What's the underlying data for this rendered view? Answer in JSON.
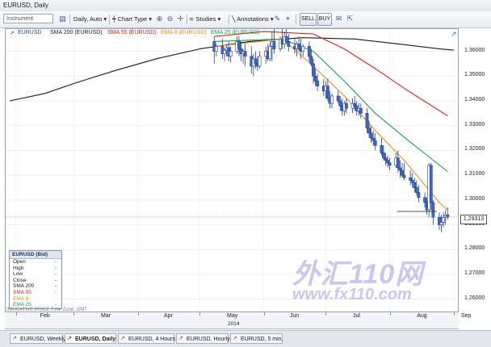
{
  "window": {
    "title": "EURUSD, Daily"
  },
  "toolbar": {
    "instrument_placeholder": "Instrument",
    "period_label": "Daily, Auto",
    "chart_type_label": "Chart Type",
    "studies_label": "Studies",
    "annotations_label": "Annotations",
    "sell_label": "SELL",
    "buy_label": "BUY",
    "icons": [
      "chart-icon",
      "zoom-in-icon",
      "zoom-out-icon",
      "crosshair-icon",
      "studies-icon",
      "line-icon",
      "pencil-icon",
      "cursor-icon",
      "email-icon",
      "export-icon"
    ]
  },
  "legend_bar": {
    "symbol": "EURUSD",
    "items": [
      {
        "label": "SMA 200 (EURUSD)",
        "color": "#1a1a1a"
      },
      {
        "label": "SMA 55 (EURUSD)",
        "color": "#e2231a"
      },
      {
        "label": "EMA 8 (EURUSD)",
        "color": "#f28b1e"
      },
      {
        "label": "EMA 25 (EURUSD)",
        "color": "#14a44d"
      }
    ]
  },
  "info_box": {
    "title": "EURUSD (Bid)",
    "rows": [
      {
        "label": "Open",
        "value": "-",
        "color": "#1a1a1a"
      },
      {
        "label": "High",
        "value": "-",
        "color": "#1a1a1a"
      },
      {
        "label": "Low",
        "value": "-",
        "color": "#1a1a1a"
      },
      {
        "label": "Close",
        "value": "-",
        "color": "#1a1a1a"
      },
      {
        "label": "SMA 200",
        "value": "-",
        "color": "#1a1a1a"
      },
      {
        "label": "SMA 55",
        "value": "-",
        "color": "#e2231a"
      },
      {
        "label": "EMA 8",
        "value": "-",
        "color": "#f28b1e"
      },
      {
        "label": "EMA 25",
        "value": "-",
        "color": "#14a44d"
      }
    ]
  },
  "footer_note": "INDICATIVE PRICE    Time Zone: GMT",
  "current_price": "1.29313",
  "tabs": [
    {
      "label": "EURUSD, Weekly",
      "active": false
    },
    {
      "label": "EURUSD, Daily",
      "active": true
    },
    {
      "label": "EURUSD, 4 Hours",
      "active": false
    },
    {
      "label": "EURUSD, Hourly",
      "active": false
    },
    {
      "label": "EURUSD, 5 min.",
      "active": false
    }
  ],
  "watermark": {
    "brand": "外汇110网",
    "url": "www.fx110.com"
  },
  "chart_data": {
    "type": "candlestick",
    "title": "EURUSD, Daily",
    "xlabel": "2014",
    "ylabel": "",
    "x_tick_labels": [
      "Feb",
      "Mar",
      "Apr",
      "May",
      "Jun",
      "Jul",
      "Aug",
      "Sep"
    ],
    "y_tick_labels": [
      "1.36000",
      "1.35000",
      "1.34000",
      "1.33000",
      "1.32000",
      "1.31000",
      "1.30000",
      "1.29000",
      "1.28000",
      "1.27000",
      "1.26000"
    ],
    "ylim": [
      1.255,
      1.369
    ],
    "grid": true,
    "current_price": 1.29313,
    "colors": {
      "up": "#ffffff",
      "down": "#3d67c9",
      "wick": "#1f3f8f",
      "price_line": "#e45a5a"
    },
    "candles": [
      {
        "d": "2014-05-08",
        "o": 1.364,
        "h": 1.366,
        "l": 1.355,
        "c": 1.36
      },
      {
        "d": "2014-05-09",
        "o": 1.36,
        "h": 1.363,
        "l": 1.358,
        "c": 1.362
      },
      {
        "d": "2014-05-12",
        "o": 1.362,
        "h": 1.365,
        "l": 1.357,
        "c": 1.359
      },
      {
        "d": "2014-05-13",
        "o": 1.359,
        "h": 1.361,
        "l": 1.356,
        "c": 1.3605
      },
      {
        "d": "2014-05-14",
        "o": 1.3605,
        "h": 1.363,
        "l": 1.358,
        "c": 1.3615
      },
      {
        "d": "2014-05-15",
        "o": 1.3615,
        "h": 1.364,
        "l": 1.356,
        "c": 1.358
      },
      {
        "d": "2014-05-16",
        "o": 1.358,
        "h": 1.362,
        "l": 1.3555,
        "c": 1.36
      },
      {
        "d": "2014-05-19",
        "o": 1.36,
        "h": 1.366,
        "l": 1.359,
        "c": 1.364
      },
      {
        "d": "2014-05-20",
        "o": 1.364,
        "h": 1.366,
        "l": 1.358,
        "c": 1.361
      },
      {
        "d": "2014-05-21",
        "o": 1.361,
        "h": 1.364,
        "l": 1.356,
        "c": 1.359
      },
      {
        "d": "2014-05-22",
        "o": 1.359,
        "h": 1.361,
        "l": 1.355,
        "c": 1.36
      },
      {
        "d": "2014-05-23",
        "o": 1.36,
        "h": 1.363,
        "l": 1.354,
        "c": 1.358
      },
      {
        "d": "2014-05-26",
        "o": 1.358,
        "h": 1.362,
        "l": 1.351,
        "c": 1.354
      },
      {
        "d": "2014-05-27",
        "o": 1.354,
        "h": 1.359,
        "l": 1.35,
        "c": 1.357
      },
      {
        "d": "2014-05-28",
        "o": 1.357,
        "h": 1.36,
        "l": 1.353,
        "c": 1.355
      },
      {
        "d": "2014-05-29",
        "o": 1.355,
        "h": 1.358,
        "l": 1.352,
        "c": 1.354
      },
      {
        "d": "2014-05-30",
        "o": 1.354,
        "h": 1.36,
        "l": 1.353,
        "c": 1.358
      },
      {
        "d": "2014-06-02",
        "o": 1.358,
        "h": 1.362,
        "l": 1.355,
        "c": 1.36
      },
      {
        "d": "2014-06-03",
        "o": 1.36,
        "h": 1.363,
        "l": 1.356,
        "c": 1.357
      },
      {
        "d": "2014-06-04",
        "o": 1.357,
        "h": 1.364,
        "l": 1.356,
        "c": 1.362
      },
      {
        "d": "2014-06-05",
        "o": 1.362,
        "h": 1.368,
        "l": 1.356,
        "c": 1.364
      },
      {
        "d": "2014-06-06",
        "o": 1.364,
        "h": 1.369,
        "l": 1.359,
        "c": 1.361
      },
      {
        "d": "2014-06-09",
        "o": 1.361,
        "h": 1.366,
        "l": 1.36,
        "c": 1.365
      },
      {
        "d": "2014-06-10",
        "o": 1.365,
        "h": 1.369,
        "l": 1.361,
        "c": 1.363
      },
      {
        "d": "2014-06-11",
        "o": 1.363,
        "h": 1.368,
        "l": 1.361,
        "c": 1.366
      },
      {
        "d": "2014-06-12",
        "o": 1.366,
        "h": 1.369,
        "l": 1.363,
        "c": 1.364
      },
      {
        "d": "2014-06-13",
        "o": 1.364,
        "h": 1.367,
        "l": 1.36,
        "c": 1.362
      },
      {
        "d": "2014-06-16",
        "o": 1.362,
        "h": 1.365,
        "l": 1.359,
        "c": 1.361
      },
      {
        "d": "2014-06-17",
        "o": 1.361,
        "h": 1.364,
        "l": 1.358,
        "c": 1.363
      },
      {
        "d": "2014-06-18",
        "o": 1.363,
        "h": 1.366,
        "l": 1.36,
        "c": 1.361
      },
      {
        "d": "2014-06-19",
        "o": 1.361,
        "h": 1.365,
        "l": 1.357,
        "c": 1.36
      },
      {
        "d": "2014-06-20",
        "o": 1.36,
        "h": 1.363,
        "l": 1.358,
        "c": 1.362
      },
      {
        "d": "2014-06-23",
        "o": 1.362,
        "h": 1.364,
        "l": 1.356,
        "c": 1.358
      },
      {
        "d": "2014-06-24",
        "o": 1.358,
        "h": 1.361,
        "l": 1.354,
        "c": 1.355
      },
      {
        "d": "2014-06-25",
        "o": 1.355,
        "h": 1.357,
        "l": 1.347,
        "c": 1.35
      },
      {
        "d": "2014-06-26",
        "o": 1.35,
        "h": 1.353,
        "l": 1.346,
        "c": 1.348
      },
      {
        "d": "2014-06-27",
        "o": 1.348,
        "h": 1.351,
        "l": 1.344,
        "c": 1.346
      },
      {
        "d": "2014-06-30",
        "o": 1.346,
        "h": 1.349,
        "l": 1.342,
        "c": 1.344
      },
      {
        "d": "2014-07-01",
        "o": 1.344,
        "h": 1.348,
        "l": 1.341,
        "c": 1.346
      },
      {
        "d": "2014-07-02",
        "o": 1.346,
        "h": 1.349,
        "l": 1.34,
        "c": 1.341
      },
      {
        "d": "2014-07-03",
        "o": 1.341,
        "h": 1.344,
        "l": 1.337,
        "c": 1.339
      },
      {
        "d": "2014-07-04",
        "o": 1.339,
        "h": 1.343,
        "l": 1.337,
        "c": 1.342
      },
      {
        "d": "2014-07-07",
        "o": 1.342,
        "h": 1.344,
        "l": 1.339,
        "c": 1.34
      },
      {
        "d": "2014-07-08",
        "o": 1.34,
        "h": 1.342,
        "l": 1.336,
        "c": 1.338
      },
      {
        "d": "2014-07-09",
        "o": 1.338,
        "h": 1.341,
        "l": 1.334,
        "c": 1.336
      },
      {
        "d": "2014-07-10",
        "o": 1.336,
        "h": 1.34,
        "l": 1.334,
        "c": 1.339
      },
      {
        "d": "2014-07-11",
        "o": 1.339,
        "h": 1.341,
        "l": 1.335,
        "c": 1.337
      },
      {
        "d": "2014-07-14",
        "o": 1.337,
        "h": 1.341,
        "l": 1.335,
        "c": 1.339
      },
      {
        "d": "2014-07-15",
        "o": 1.339,
        "h": 1.342,
        "l": 1.336,
        "c": 1.338
      },
      {
        "d": "2014-07-16",
        "o": 1.338,
        "h": 1.34,
        "l": 1.334,
        "c": 1.336
      },
      {
        "d": "2014-07-17",
        "o": 1.336,
        "h": 1.339,
        "l": 1.334,
        "c": 1.337
      },
      {
        "d": "2014-07-18",
        "o": 1.337,
        "h": 1.339,
        "l": 1.333,
        "c": 1.335
      },
      {
        "d": "2014-07-21",
        "o": 1.335,
        "h": 1.337,
        "l": 1.327,
        "c": 1.329
      },
      {
        "d": "2014-07-22",
        "o": 1.329,
        "h": 1.332,
        "l": 1.325,
        "c": 1.327
      },
      {
        "d": "2014-07-23",
        "o": 1.327,
        "h": 1.33,
        "l": 1.323,
        "c": 1.325
      },
      {
        "d": "2014-07-24",
        "o": 1.325,
        "h": 1.328,
        "l": 1.322,
        "c": 1.324
      },
      {
        "d": "2014-07-25",
        "o": 1.324,
        "h": 1.327,
        "l": 1.32,
        "c": 1.322
      },
      {
        "d": "2014-07-28",
        "o": 1.322,
        "h": 1.325,
        "l": 1.318,
        "c": 1.319
      },
      {
        "d": "2014-07-29",
        "o": 1.319,
        "h": 1.322,
        "l": 1.316,
        "c": 1.317
      },
      {
        "d": "2014-07-30",
        "o": 1.317,
        "h": 1.319,
        "l": 1.314,
        "c": 1.316
      },
      {
        "d": "2014-07-31",
        "o": 1.316,
        "h": 1.318,
        "l": 1.313,
        "c": 1.315
      },
      {
        "d": "2014-08-01",
        "o": 1.315,
        "h": 1.317,
        "l": 1.312,
        "c": 1.314
      },
      {
        "d": "2014-08-04",
        "o": 1.314,
        "h": 1.319,
        "l": 1.313,
        "c": 1.317
      },
      {
        "d": "2014-08-05",
        "o": 1.317,
        "h": 1.32,
        "l": 1.311,
        "c": 1.313
      },
      {
        "d": "2014-08-06",
        "o": 1.313,
        "h": 1.316,
        "l": 1.309,
        "c": 1.312
      },
      {
        "d": "2014-08-07",
        "o": 1.312,
        "h": 1.315,
        "l": 1.309,
        "c": 1.31
      },
      {
        "d": "2014-08-08",
        "o": 1.31,
        "h": 1.315,
        "l": 1.308,
        "c": 1.309
      },
      {
        "d": "2014-08-11",
        "o": 1.309,
        "h": 1.312,
        "l": 1.306,
        "c": 1.308
      },
      {
        "d": "2014-08-12",
        "o": 1.308,
        "h": 1.311,
        "l": 1.305,
        "c": 1.307
      },
      {
        "d": "2014-08-13",
        "o": 1.307,
        "h": 1.309,
        "l": 1.303,
        "c": 1.305
      },
      {
        "d": "2014-08-14",
        "o": 1.305,
        "h": 1.308,
        "l": 1.302,
        "c": 1.303
      },
      {
        "d": "2014-08-15",
        "o": 1.303,
        "h": 1.306,
        "l": 1.299,
        "c": 1.301
      },
      {
        "d": "2014-08-18",
        "o": 1.301,
        "h": 1.303,
        "l": 1.297,
        "c": 1.299
      },
      {
        "d": "2014-08-19",
        "o": 1.299,
        "h": 1.301,
        "l": 1.294,
        "c": 1.296
      },
      {
        "d": "2014-08-20",
        "o": 1.296,
        "h": 1.315,
        "l": 1.293,
        "c": 1.314
      },
      {
        "d": "2014-08-21",
        "o": 1.314,
        "h": 1.315,
        "l": 1.296,
        "c": 1.299
      },
      {
        "d": "2014-08-22",
        "o": 1.299,
        "h": 1.3,
        "l": 1.29,
        "c": 1.293
      },
      {
        "d": "2014-08-25",
        "o": 1.293,
        "h": 1.295,
        "l": 1.288,
        "c": 1.29
      },
      {
        "d": "2014-08-26",
        "o": 1.29,
        "h": 1.294,
        "l": 1.287,
        "c": 1.291
      },
      {
        "d": "2014-08-27",
        "o": 1.291,
        "h": 1.295,
        "l": 1.289,
        "c": 1.293
      },
      {
        "d": "2014-08-28",
        "o": 1.293,
        "h": 1.296,
        "l": 1.29,
        "c": 1.294
      },
      {
        "d": "2014-08-29",
        "o": 1.294,
        "h": 1.297,
        "l": 1.292,
        "c": 1.2931
      }
    ],
    "series": [
      {
        "name": "SMA 200 (EURUSD)",
        "color": "#1a1a1a",
        "points": [
          [
            "2014-01-29",
            1.34
          ],
          [
            "2014-02-15",
            1.343
          ],
          [
            "2014-03-01",
            1.347
          ],
          [
            "2014-03-20",
            1.352
          ],
          [
            "2014-04-10",
            1.357
          ],
          [
            "2014-05-01",
            1.361
          ],
          [
            "2014-05-25",
            1.364
          ],
          [
            "2014-06-20",
            1.3655
          ],
          [
            "2014-07-15",
            1.365
          ],
          [
            "2014-08-05",
            1.363
          ],
          [
            "2014-08-25",
            1.361
          ],
          [
            "2014-09-01",
            1.3605
          ]
        ]
      },
      {
        "name": "SMA 55 (EURUSD)",
        "color": "#e2231a",
        "points": [
          [
            "2014-05-08",
            1.366
          ],
          [
            "2014-06-01",
            1.368
          ],
          [
            "2014-06-25",
            1.367
          ],
          [
            "2014-07-10",
            1.361
          ],
          [
            "2014-07-25",
            1.353
          ],
          [
            "2014-08-10",
            1.344
          ],
          [
            "2014-08-29",
            1.334
          ]
        ]
      },
      {
        "name": "EMA 25 (EURUSD)",
        "color": "#14a44d",
        "points": [
          [
            "2014-05-08",
            1.364
          ],
          [
            "2014-06-10",
            1.365
          ],
          [
            "2014-06-25",
            1.36
          ],
          [
            "2014-07-10",
            1.348
          ],
          [
            "2014-07-25",
            1.335
          ],
          [
            "2014-08-10",
            1.324
          ],
          [
            "2014-08-29",
            1.3115
          ]
        ]
      },
      {
        "name": "EMA 8 (EURUSD)",
        "color": "#f28b1e",
        "points": [
          [
            "2014-05-08",
            1.362
          ],
          [
            "2014-06-10",
            1.365
          ],
          [
            "2014-06-25",
            1.354
          ],
          [
            "2014-07-10",
            1.342
          ],
          [
            "2014-07-25",
            1.328
          ],
          [
            "2014-08-08",
            1.316
          ],
          [
            "2014-08-18",
            1.306
          ],
          [
            "2014-08-25",
            1.299
          ],
          [
            "2014-08-29",
            1.296
          ]
        ]
      }
    ]
  }
}
